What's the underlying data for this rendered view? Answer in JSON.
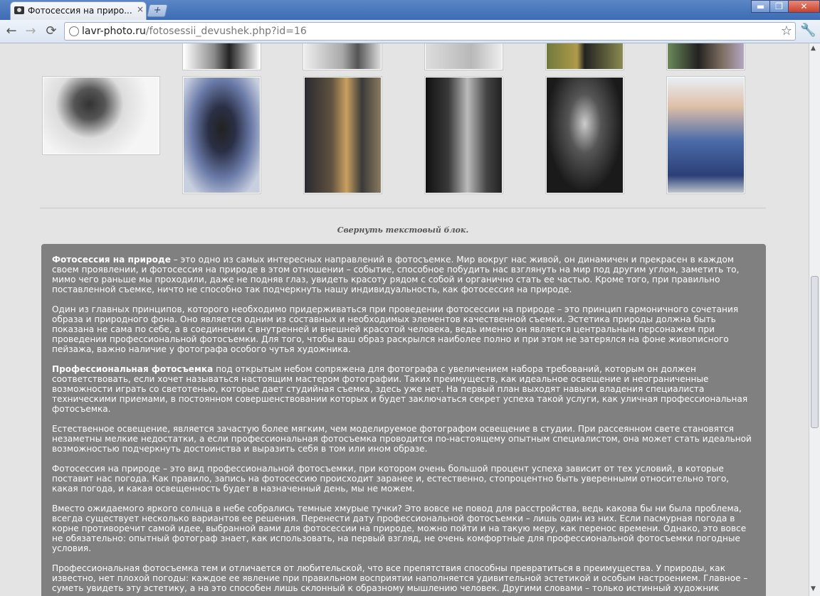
{
  "browser": {
    "tab_title": "Фотосессия на приро...",
    "tab_close": "×",
    "new_tab": "+",
    "window_buttons": {
      "minimize": "▬",
      "maximize": "❐",
      "close": "✕"
    },
    "nav": {
      "back": "←",
      "forward": "→",
      "reload": "⟳"
    },
    "url_host": "lavr-photo.ru",
    "url_path": "/fotosessii_devushek.php?id=16",
    "bookmark_star": "☆",
    "wrench": "🔧"
  },
  "gallery": {
    "top_row_colors": [
      "#8a8a8a",
      "#a9a9a9",
      "#b8b8b8",
      "#6f7a3e",
      "#7b6b5e"
    ],
    "row_colors": [
      "#7a7a7a",
      "#4a5a8a",
      "#5e5140",
      "#3a3a3a",
      "#565656",
      "#4b6ba8"
    ]
  },
  "collapse_link": "Свернуть текстовый блок.",
  "article": {
    "p1_bold": "Фотосессия на природе",
    "p1_text": " – это одно из самых интересных направлений в фотосъемке. Мир вокруг нас живой, он динамичен и прекрасен в каждом своем проявлении, и фотосессия на природе в этом отношении – событие, способное побудить нас взглянуть на мир под другим углом, заметить то, мимо чего раньше мы проходили, даже не подняв глаз, увидеть красоту рядом с собой и органично стать ее частью. Кроме того, при правильно поставленной съемке, ничто не способно так подчеркнуть нашу индивидуальность, как фотосессия на природе.",
    "p2": "Один из главных принципов, которого необходимо придерживаться при проведении фотосессии на природе – это принцип гармоничного сочетания образа и природного фона. Оно является одним из составных и необходимых элементов качественной съемки. Эстетика природы должна быть показана не сама по себе, а в соединении с внутренней и внешней красотой человека, ведь именно он является центральным персонажем при проведении профессиональной фотосъемки. Для того, чтобы ваш образ раскрылся наиболее полно и при этом не затерялся на фоне живописного пейзажа, важно наличие у фотографа особого чутья художника.",
    "p3_bold": "Профессиональная фотосъемка",
    "p3_text": " под открытым небом сопряжена для фотографа с увеличением набора требований, которым он должен соответствовать, если хочет называться настоящим мастером фотографии. Таких преимуществ, как идеальное освещение и неограниченные возможности играть со светотенью, которые дает студийная съемка, здесь уже нет. На первый план выходят навыки владения специалиста техническими приемами,  в постоянном совершенствовании которых и будет заключаться секрет успеха такой услуги, как уличная профессиональная фотосъемка.",
    "p4": "Естественное освещение, является зачастую более мягким, чем моделируемое фотографом освещение в студии. При рассеянном свете становятся незаметны мелкие недостатки, а если профессиональная фотосъемка проводится по-настоящему опытным специалистом, она может стать идеальной возможностью подчеркнуть достоинства и выразить себя в том или ином образе.",
    "p5": "Фотосессия на природе – это вид профессиональной фотосъемки,  при котором очень большой процент успеха зависит от тех условий, в которые поставит нас погода. Как правило, запись на фотосессию происходит заранее и, естественно, стопроцентно быть уверенными относительно того, какая погода, и какая освещенность будет в назначенный день, мы не можем.",
    "p6": "Вместо ожидаемого яркого солнца в небе собрались темные хмурые тучки? Это вовсе не повод для расстройства, ведь какова бы ни была проблема, всегда существует несколько вариантов ее решения. Перенести дату профессиональной фотосъемки – лишь один из них. Если пасмурная погода в корне противоречит самой идее, выбранной вами для фотосессии на природе, можно пойти и на такую меру, как перенос времени. Однако, это вовсе не обязательно: опытный фотограф знает, как использовать, на первый взгляд, не очень комфортные для профессиональной фотосъемки погодные условия.",
    "p7": "Профессиональная фотосъемка тем и отличается от любительской, что все препятствия способны превратиться в преимущества. У природы, как известно, нет плохой погоды: каждое ее явление при правильном восприятии наполняется удивительной эстетикой и особым настроением. Главное – суметь увидеть эту эстетику, а на это способен лишь склонный к образному мышлению человек. Другими словами – только истинный художник"
  }
}
